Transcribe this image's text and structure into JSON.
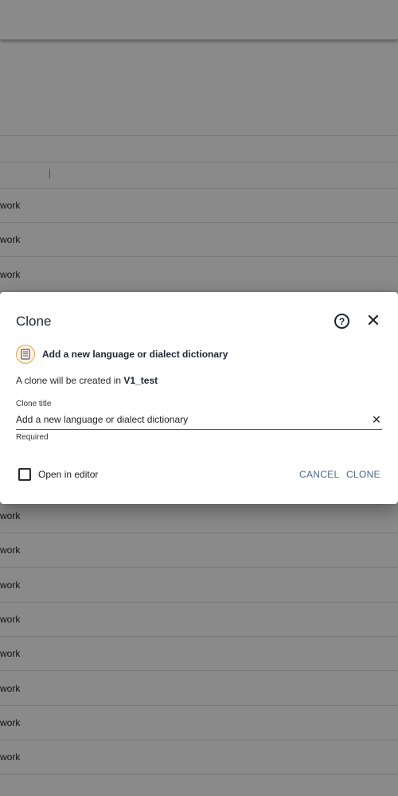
{
  "background": {
    "row_label": "work",
    "rows": [
      "work",
      "work",
      "work",
      "work",
      "work",
      "work",
      "work",
      "work",
      "work",
      "work",
      "work"
    ]
  },
  "dialog": {
    "title": "Clone",
    "help_icon": "help-circle-icon",
    "close_icon": "close-icon",
    "template_icon": "document-icon",
    "template_name": "Add a new language or dialect dictionary",
    "clone_info_prefix": "A clone will be created in ",
    "clone_target": "V1_test",
    "field": {
      "label": "Clone title",
      "value": "Add a new language or dialect dictionary",
      "helper": "Required"
    },
    "open_in_editor_label": "Open in editor",
    "open_in_editor_checked": false,
    "cancel_label": "CANCEL",
    "clone_label": "CLONE",
    "accent_color": "#4b6a8e",
    "template_icon_color": "#e8a04a"
  }
}
